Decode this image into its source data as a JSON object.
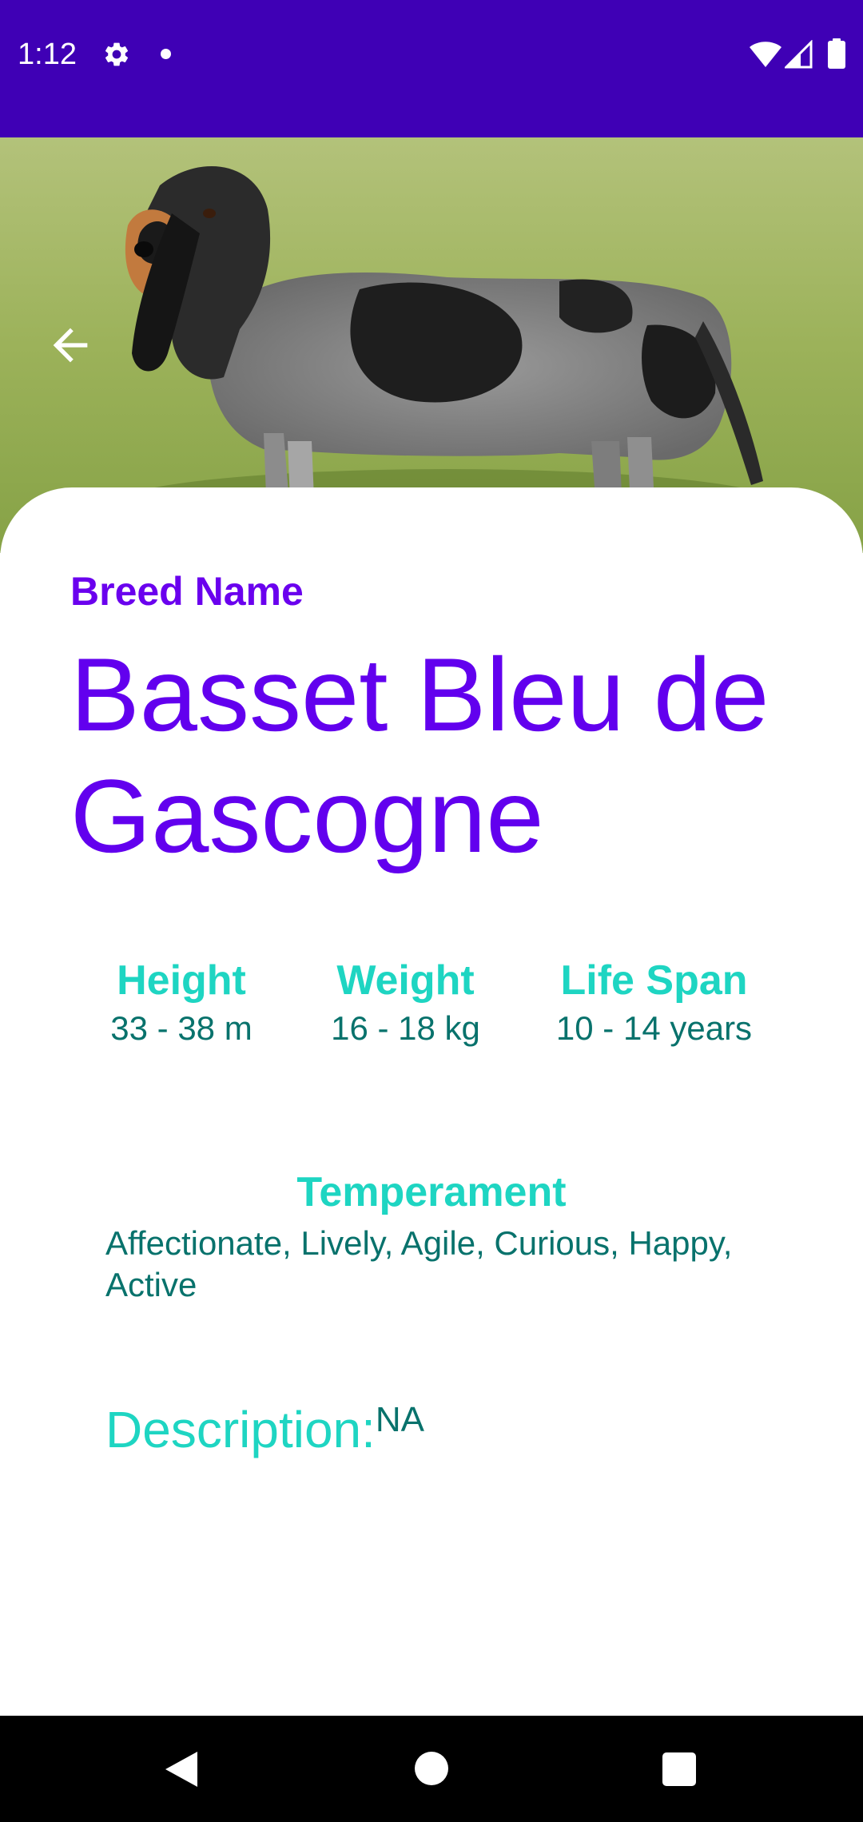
{
  "status_bar": {
    "time": "1:12",
    "icons": [
      "settings-gear-icon",
      "notification-dot-icon",
      "wifi-icon",
      "cell-signal-icon",
      "battery-icon"
    ],
    "background_color": "#3f00b5"
  },
  "hero": {
    "image_subject": "dog-photo",
    "back_icon": "arrow-left-icon"
  },
  "breed": {
    "label": "Breed Name",
    "name": "Basset Bleu de Gascogne"
  },
  "stats": [
    {
      "title": "Height",
      "value": "33 - 38 m"
    },
    {
      "title": "Weight",
      "value": "16 - 18 kg"
    },
    {
      "title": "Life Span",
      "value": "10 - 14 years"
    }
  ],
  "temperament": {
    "title": "Temperament",
    "value": "Affectionate, Lively, Agile, Curious, Happy, Active"
  },
  "description": {
    "label": "Description:",
    "value": "NA"
  },
  "nav_bar": {
    "icons": [
      "nav-back-icon",
      "nav-home-icon",
      "nav-recents-icon"
    ]
  },
  "colors": {
    "primary_purple": "#6200ee",
    "status_bar": "#3f00b5",
    "teal_title": "#1ed5c2",
    "teal_value": "#08726c"
  }
}
